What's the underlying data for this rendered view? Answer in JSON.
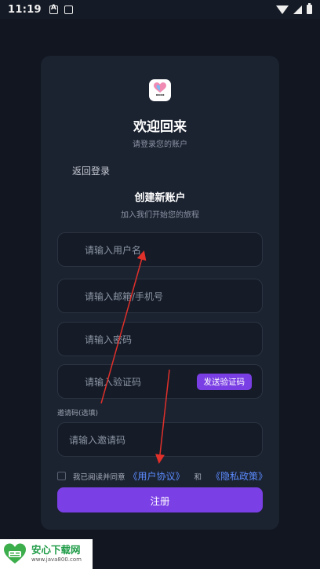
{
  "status_bar": {
    "time": "11:19",
    "icons": [
      "a-notification-icon",
      "screen-icon",
      "wifi-icon",
      "signal-icon",
      "battery-icon"
    ]
  },
  "card": {
    "welcome_title": "欢迎回来",
    "welcome_subtitle": "请登录您的账户",
    "back_login": "返回登录",
    "create_title": "创建新账户",
    "create_subtitle": "加入我们开始您的旅程"
  },
  "form": {
    "username_placeholder": "请输入用户名",
    "email_phone_placeholder": "请输入邮箱/手机号",
    "password_placeholder": "请输入密码",
    "code_placeholder": "请输入验证码",
    "send_code_label": "发送验证码",
    "invite_label": "邀请码(选填)",
    "invite_placeholder": "请输入邀请码",
    "agree_prefix": "我已阅读并同意",
    "user_agreement": "《用户协议》",
    "and": "和",
    "privacy_policy": "《隐私政策》",
    "register_label": "注册"
  },
  "watermark": {
    "title": "安心下载网",
    "url": "www.java800.com"
  },
  "colors": {
    "background": "#111620",
    "card": "#1b2230",
    "accent": "#7b3fe6",
    "link": "#5b8cff",
    "annotation_arrow": "#e0302a"
  }
}
